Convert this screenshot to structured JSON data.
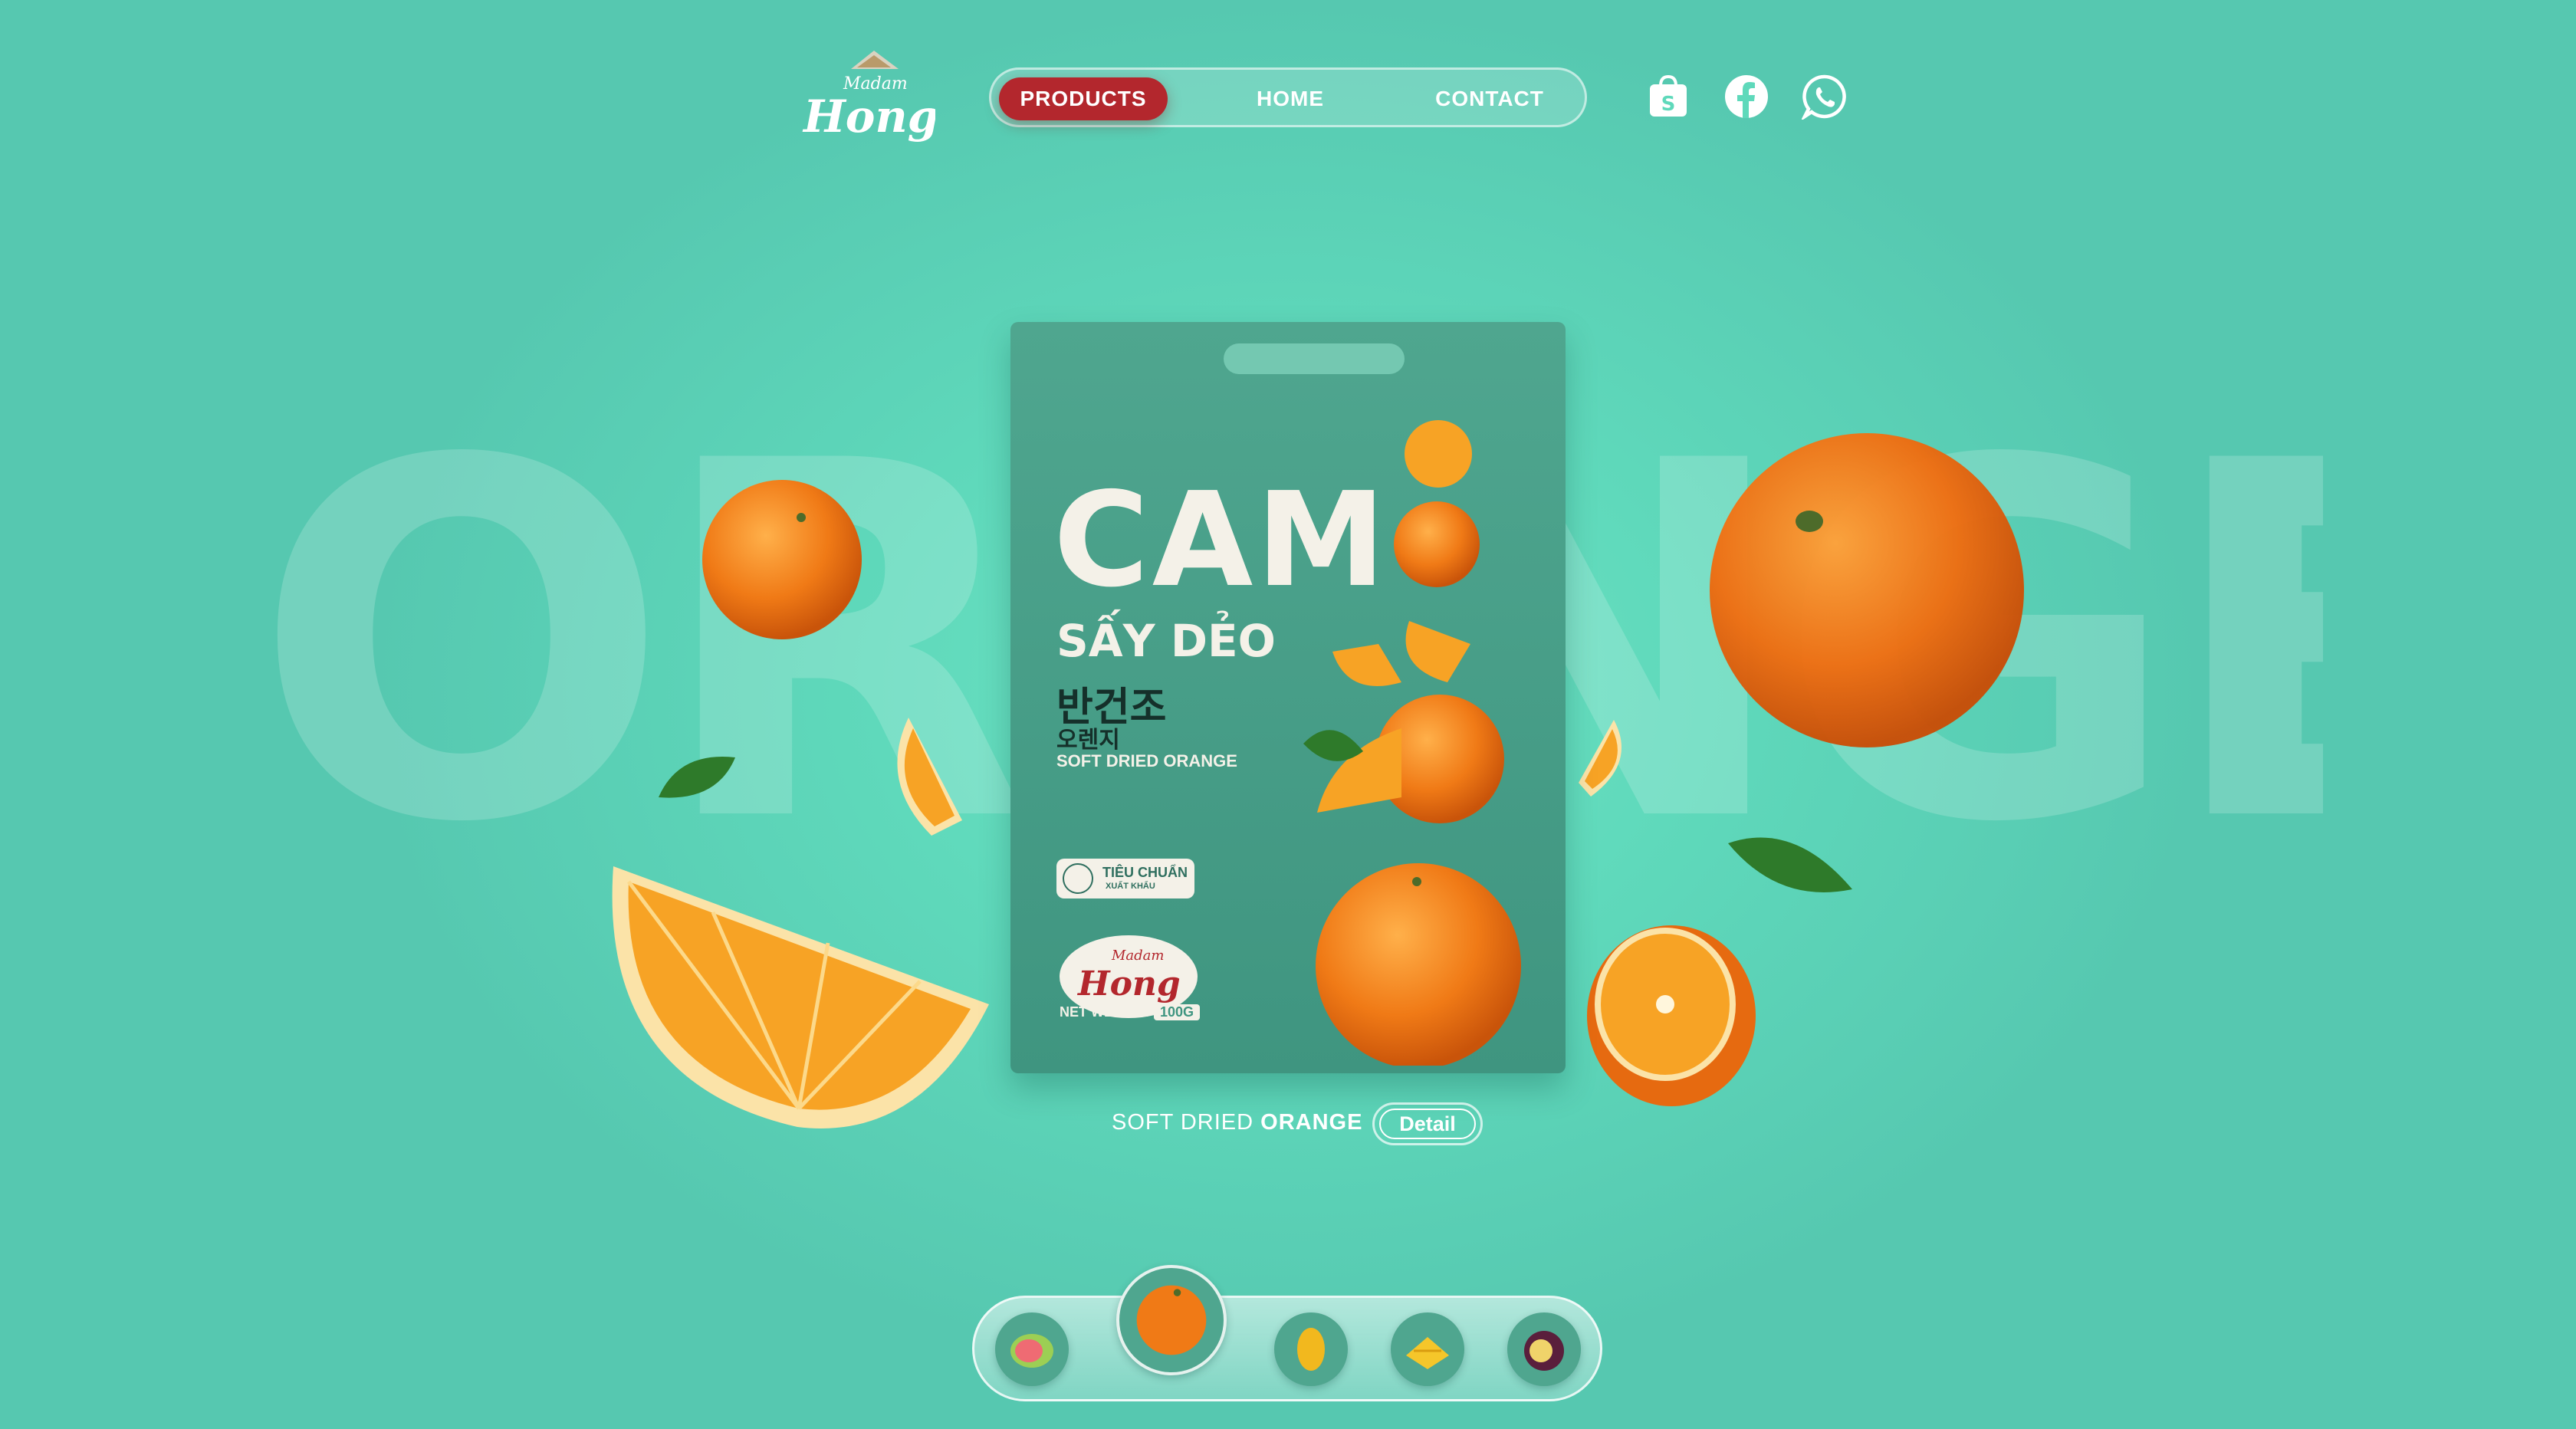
{
  "brand": {
    "logo_name": "Madam",
    "logo_main": "Hong"
  },
  "nav": {
    "items": [
      {
        "label": "PRODUCTS",
        "active": true
      },
      {
        "label": "HOME",
        "active": false
      },
      {
        "label": "CONTACT",
        "active": false
      }
    ]
  },
  "social": [
    "shopee-bag-icon",
    "facebook-icon",
    "whatsapp-icon"
  ],
  "background_word": "ORANGE",
  "package": {
    "title": "CAM",
    "subtitle": "SẤY DẺO",
    "korean_main": "반건조",
    "korean_sub": "오렌지",
    "english": "SOFT DRIED ORANGE",
    "badge_line1": "TIÊU CHUẨN",
    "badge_line2": "XUẤT KHẨU",
    "logo_name": "Madam",
    "logo_main": "Hong",
    "net_weight_label": "NET WEIGHT:",
    "net_weight_value": "100G"
  },
  "caption": {
    "prefix": "SOFT DRIED",
    "name": "ORANGE",
    "detail_label": "Detail"
  },
  "product_selector": {
    "items": [
      "guava",
      "orange",
      "mango",
      "pineapple",
      "passion-fruit"
    ],
    "active": "orange"
  },
  "colors": {
    "accent": "#b3272d",
    "background": "#5fd9bb",
    "package": "#4fa68f",
    "orange": "#f07a16"
  }
}
